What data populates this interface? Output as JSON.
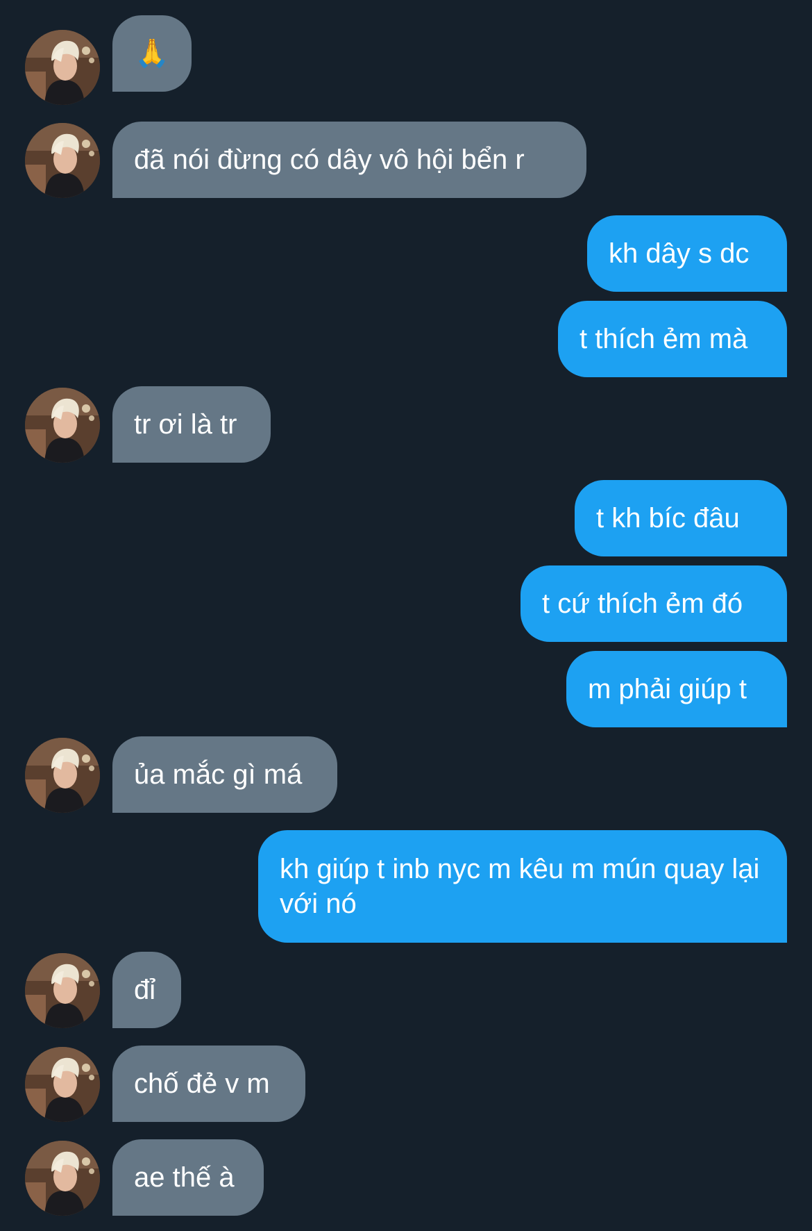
{
  "conversation": {
    "messages": [
      {
        "side": "in",
        "text": "🙏"
      },
      {
        "side": "in",
        "text": "đã nói đừng có dây vô hội bển r"
      },
      {
        "side": "out",
        "text": "kh dây s dc"
      },
      {
        "side": "out",
        "text": "t thích ẻm mà"
      },
      {
        "side": "in",
        "text": "tr ơi là tr"
      },
      {
        "side": "out",
        "text": "t kh bíc đâu"
      },
      {
        "side": "out",
        "text": "t cứ thích ẻm đó"
      },
      {
        "side": "out",
        "text": "m phải giúp t"
      },
      {
        "side": "in",
        "text": "ủa mắc gì má"
      },
      {
        "side": "out",
        "text": "kh giúp t inb nyc m kêu m mún quay lại với nó"
      },
      {
        "side": "in",
        "text": "đỉ"
      },
      {
        "side": "in",
        "text": "chố đẻ v m"
      },
      {
        "side": "in",
        "text": "ae thế à"
      }
    ]
  },
  "colors": {
    "background": "#15202b",
    "incoming_bubble": "#657786",
    "outgoing_bubble": "#1da1f2",
    "text": "#ffffff"
  },
  "icons": {
    "avatar": "user-avatar"
  }
}
